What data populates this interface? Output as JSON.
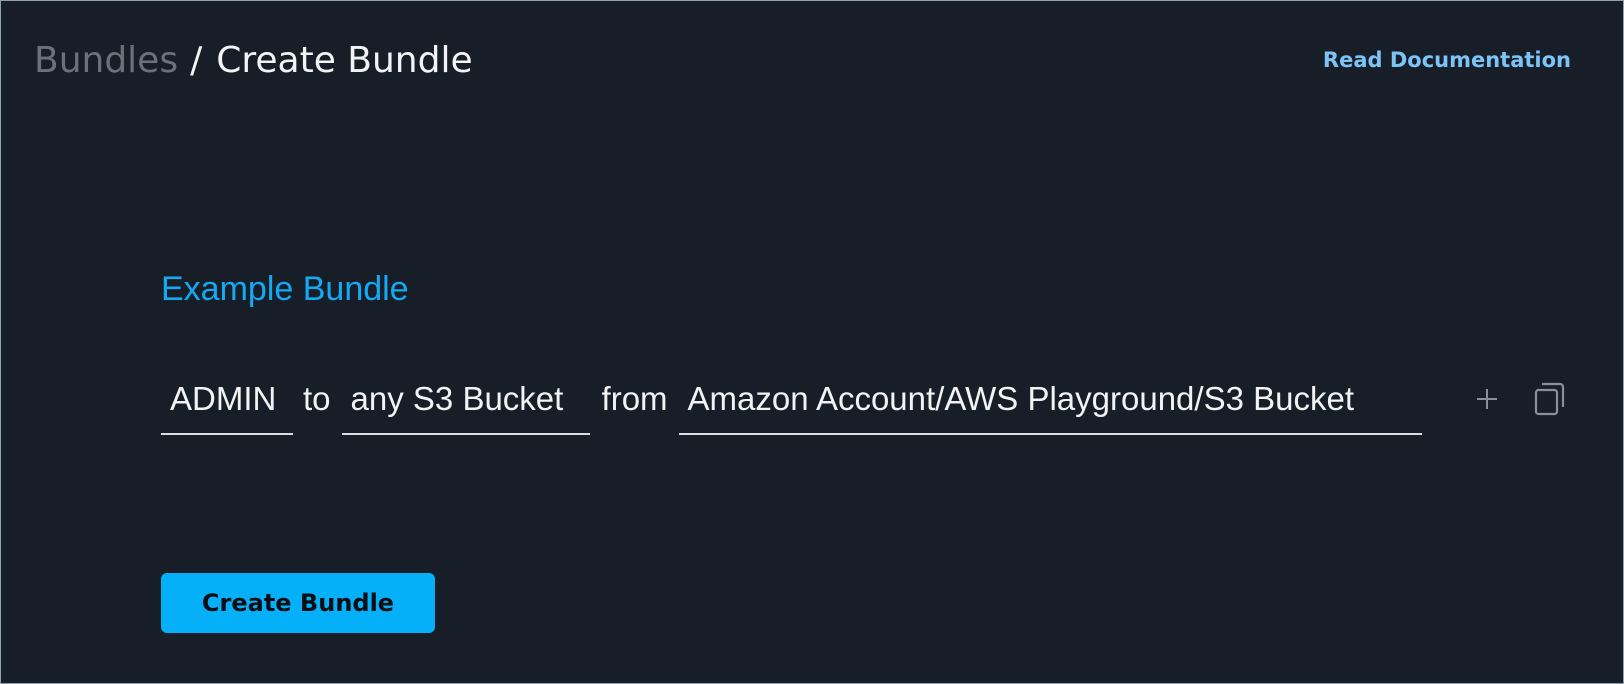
{
  "header": {
    "breadcrumb": {
      "parent": "Bundles",
      "separator": "/",
      "current": "Create Bundle"
    },
    "doc_link_label": "Read Documentation"
  },
  "main": {
    "section_title": "Example Bundle",
    "bundle": {
      "role_value": "ADMIN",
      "connector_to": "to",
      "resource_value": "any S3 Bucket",
      "connector_from": "from",
      "source_value": "Amazon Account/AWS Playground/S3 Bucket"
    },
    "actions": {
      "add_icon": "plus-icon",
      "duplicate_icon": "copy-icon"
    },
    "submit_label": "Create Bundle"
  },
  "colors": {
    "background": "#181e28",
    "accent": "#14a9f2",
    "link": "#7cc4f6",
    "button": "#06b0f9",
    "muted_text": "#6b7079",
    "text": "#f1f3f5"
  }
}
